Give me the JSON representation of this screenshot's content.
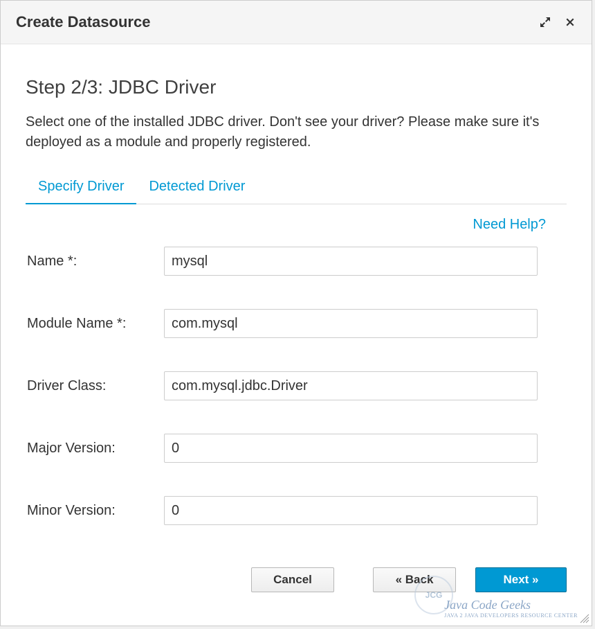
{
  "dialog": {
    "title": "Create Datasource"
  },
  "step": {
    "title": "Step 2/3: JDBC Driver",
    "description": "Select one of the installed JDBC driver. Don't see your driver? Please make sure it's deployed as a module and properly registered."
  },
  "tabs": {
    "specify": "Specify Driver",
    "detected": "Detected Driver"
  },
  "help": {
    "link": "Need Help?"
  },
  "form": {
    "name_label": "Name *:",
    "name_value": "mysql",
    "module_label": "Module Name *:",
    "module_value": "com.mysql",
    "driver_label": "Driver Class:",
    "driver_value": "com.mysql.jdbc.Driver",
    "major_label": "Major Version:",
    "major_value": "0",
    "minor_label": "Minor Version:",
    "minor_value": "0"
  },
  "buttons": {
    "cancel": "Cancel",
    "back": "« Back",
    "next": "Next »"
  },
  "watermark": {
    "main": "Java Code Geeks",
    "sub": "JAVA 2 JAVA DEVELOPERS RESOURCE CENTER",
    "badge": "JCG"
  }
}
